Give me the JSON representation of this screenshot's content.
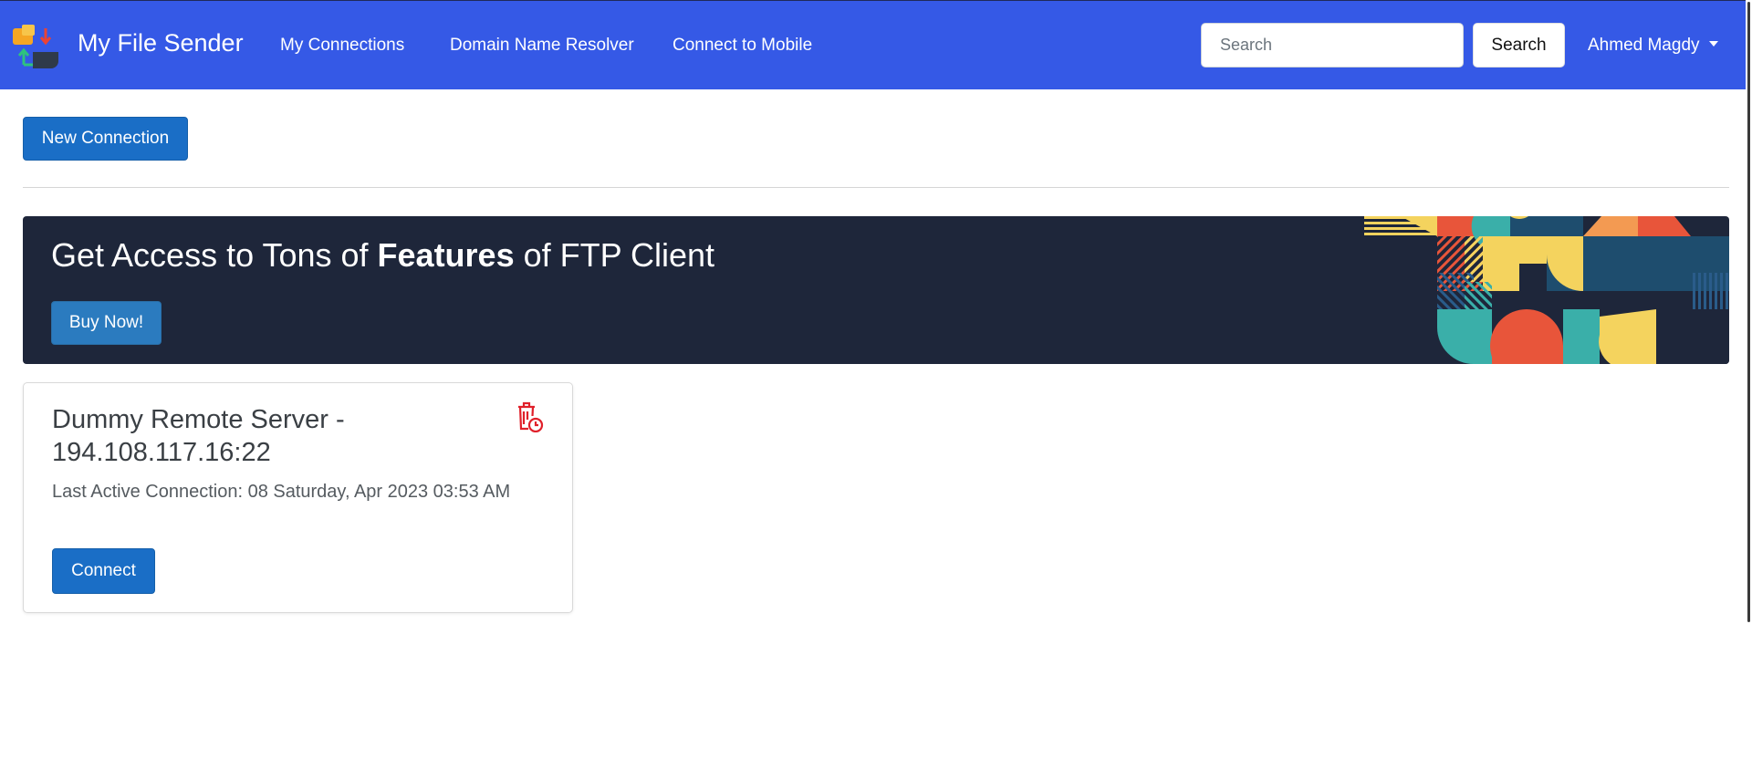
{
  "navbar": {
    "brand": "My File Sender",
    "links": [
      "My Connections",
      "Domain Name Resolver",
      "Connect to Mobile"
    ],
    "search": {
      "placeholder": "Search",
      "value": "",
      "button_label": "Search"
    },
    "user": "Ahmed Magdy",
    "background_color": "#3559e6"
  },
  "main": {
    "new_connection_label": "New Connection"
  },
  "banner": {
    "title_prefix": "Get Access to Tons of ",
    "title_bold": "Features",
    "title_suffix": " of FTP Client",
    "button_label": "Buy Now!",
    "background_color": "#1e263a"
  },
  "connections": [
    {
      "title": "Dummy Remote Server - 194.108.117.16:22",
      "last_active": "Last Active Connection: 08 Saturday, Apr 2023 03:53 AM",
      "connect_label": "Connect"
    }
  ],
  "icons": {
    "logo": "app-logo-icon",
    "delete": "trash-clock-icon",
    "dropdown": "caret-down-icon"
  },
  "colors": {
    "primary_button": "#1a6ec6",
    "delete_icon": "#e0202a"
  }
}
